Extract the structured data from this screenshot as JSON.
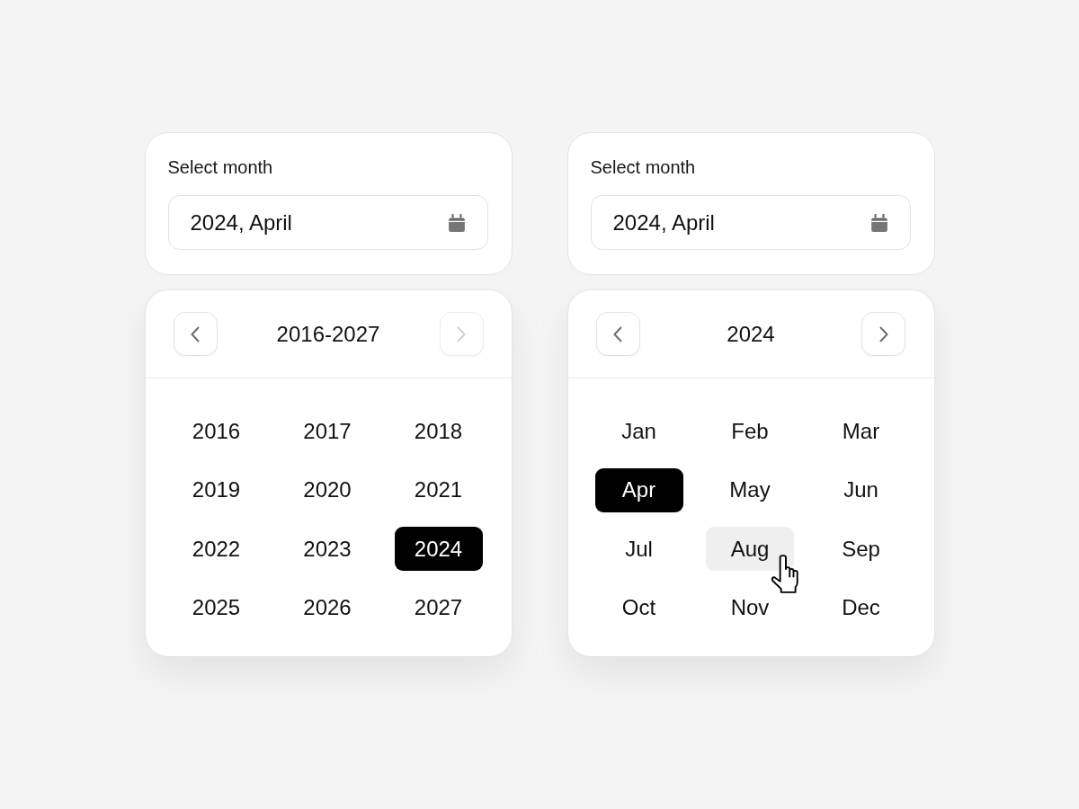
{
  "pickers": [
    {
      "label": "Select month",
      "field": {
        "value": "2024, April"
      },
      "header": {
        "title": "2016-2027",
        "prev": {
          "disabled": false
        },
        "next": {
          "disabled": true
        }
      },
      "cells": [
        {
          "label": "2016",
          "selected": false,
          "hovered": false
        },
        {
          "label": "2017",
          "selected": false,
          "hovered": false
        },
        {
          "label": "2018",
          "selected": false,
          "hovered": false
        },
        {
          "label": "2019",
          "selected": false,
          "hovered": false
        },
        {
          "label": "2020",
          "selected": false,
          "hovered": false
        },
        {
          "label": "2021",
          "selected": false,
          "hovered": false
        },
        {
          "label": "2022",
          "selected": false,
          "hovered": false
        },
        {
          "label": "2023",
          "selected": false,
          "hovered": false
        },
        {
          "label": "2024",
          "selected": true,
          "hovered": false
        },
        {
          "label": "2025",
          "selected": false,
          "hovered": false
        },
        {
          "label": "2026",
          "selected": false,
          "hovered": false
        },
        {
          "label": "2027",
          "selected": false,
          "hovered": false
        }
      ]
    },
    {
      "label": "Select month",
      "field": {
        "value": "2024, April"
      },
      "header": {
        "title": "2024",
        "prev": {
          "disabled": false
        },
        "next": {
          "disabled": false
        }
      },
      "cells": [
        {
          "label": "Jan",
          "selected": false,
          "hovered": false
        },
        {
          "label": "Feb",
          "selected": false,
          "hovered": false
        },
        {
          "label": "Mar",
          "selected": false,
          "hovered": false
        },
        {
          "label": "Apr",
          "selected": true,
          "hovered": false
        },
        {
          "label": "May",
          "selected": false,
          "hovered": false
        },
        {
          "label": "Jun",
          "selected": false,
          "hovered": false
        },
        {
          "label": "Jul",
          "selected": false,
          "hovered": false
        },
        {
          "label": "Aug",
          "selected": false,
          "hovered": true
        },
        {
          "label": "Sep",
          "selected": false,
          "hovered": false
        },
        {
          "label": "Oct",
          "selected": false,
          "hovered": false
        },
        {
          "label": "Nov",
          "selected": false,
          "hovered": false
        },
        {
          "label": "Dec",
          "selected": false,
          "hovered": false
        }
      ]
    }
  ]
}
